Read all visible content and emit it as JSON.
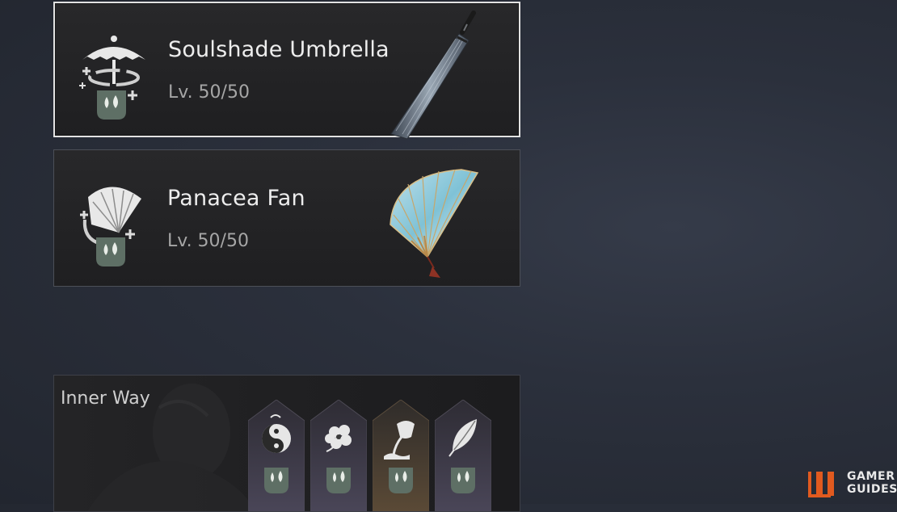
{
  "weapons": [
    {
      "name": "Soulshade Umbrella",
      "level": "Lv. 50/50",
      "icon": "umbrella-skill-icon",
      "art": "umbrella-art",
      "selected": true
    },
    {
      "name": "Panacea Fan",
      "level": "Lv. 50/50",
      "icon": "fan-skill-icon",
      "art": "fan-art",
      "selected": false
    }
  ],
  "inner_way": {
    "title": "Inner Way",
    "slots": [
      {
        "icon": "yin-yang-icon"
      },
      {
        "icon": "blossom-icon"
      },
      {
        "icon": "pouring-vessel-icon"
      },
      {
        "icon": "leaf-icon"
      }
    ]
  },
  "watermark": {
    "line1": "GAMER",
    "line2": "GUIDES",
    "logo": "gamer-guides-logo"
  },
  "colors": {
    "accent_orange": "#e15a1f",
    "badge_green": "#5e6f65",
    "selected_border": "#e2e2e2"
  }
}
